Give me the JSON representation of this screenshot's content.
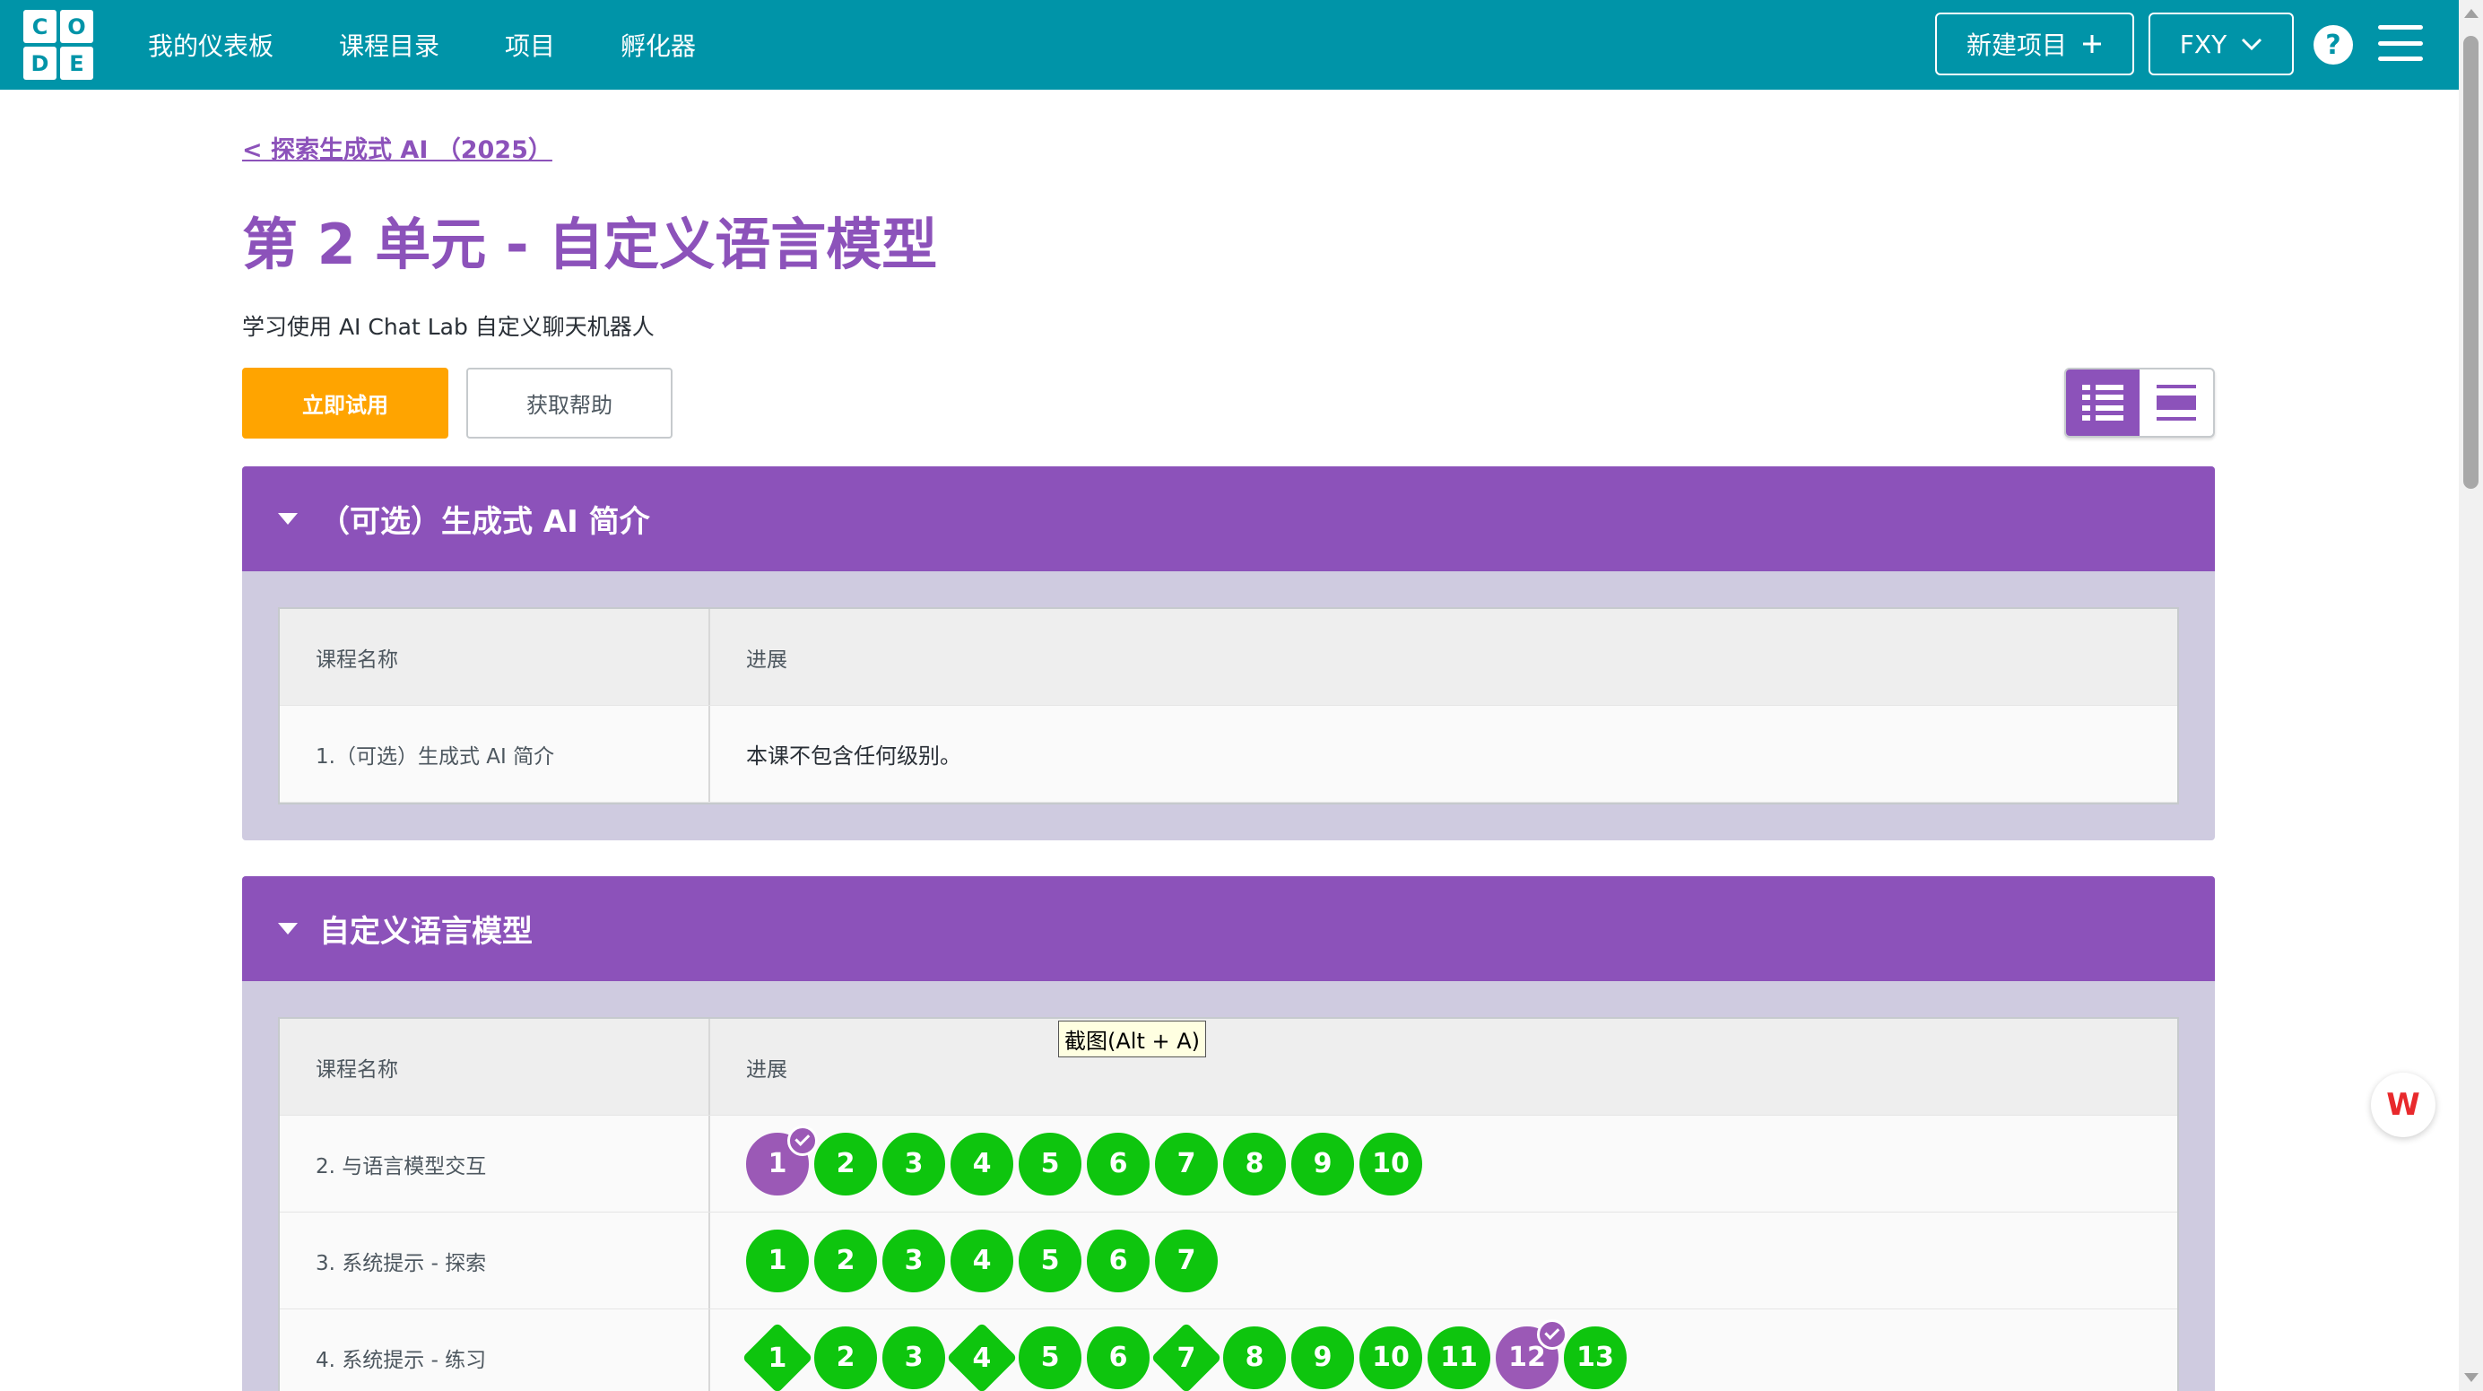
{
  "header": {
    "logo_letters": [
      "C",
      "O",
      "D",
      "E"
    ],
    "nav": [
      "我的仪表板",
      "课程目录",
      "项目",
      "孵化器"
    ],
    "new_project": "新建项目",
    "new_project_icon": "plus-icon",
    "user": "FXY",
    "user_icon": "chevron-down-icon",
    "help": "?",
    "menu_icon": "hamburger-menu-icon"
  },
  "breadcrumb": "< 探索生成式 AI （2025）",
  "page_title": "第 2 单元 - 自定义语言模型",
  "subtitle": "学习使用 AI Chat Lab 自定义聊天机器人",
  "buttons": {
    "try_now": "立即试用",
    "get_help": "获取帮助"
  },
  "colors": {
    "brand": "#0094a8",
    "purple": "#8c52ba",
    "orange": "#ffa400",
    "green": "#0ec50e"
  },
  "sections": [
    {
      "title": "（可选）生成式 AI 简介",
      "col_name": "课程名称",
      "col_progress": "进展",
      "rows": [
        {
          "name": "1.（可选）生成式 AI 简介",
          "progress_text": "本课不包含任何级别。"
        }
      ]
    },
    {
      "title": "自定义语言模型",
      "col_name": "课程名称",
      "col_progress": "进展",
      "rows": [
        {
          "name": "2. 与语言模型交互",
          "levels": [
            "1",
            "2",
            "3",
            "4",
            "5",
            "6",
            "7",
            "8",
            "9",
            "10"
          ]
        },
        {
          "name": "3. 系统提示 - 探索",
          "levels": [
            "1",
            "2",
            "3",
            "4",
            "5",
            "6",
            "7"
          ]
        },
        {
          "name": "4. 系统提示 - 练习",
          "levels": [
            "1",
            "2",
            "3",
            "4",
            "5",
            "6",
            "7",
            "8",
            "9",
            "10",
            "11",
            "12",
            "13"
          ]
        }
      ]
    }
  ],
  "tooltip": "截图(Alt + A)",
  "floating_badge": "W"
}
